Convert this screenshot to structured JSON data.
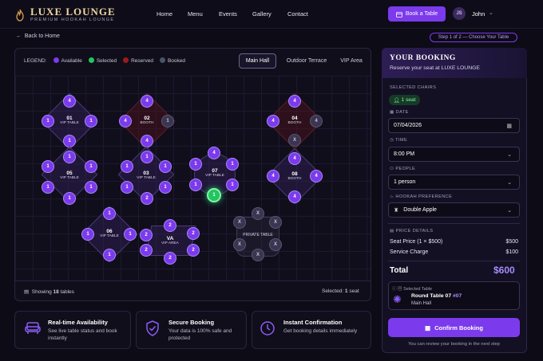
{
  "brand": {
    "name": "LUXE LOUNGE",
    "tagline": "PREMIUM HOOKAH LOUNGE"
  },
  "nav": {
    "links": [
      "Home",
      "Menu",
      "Events",
      "Gallery",
      "Contact"
    ],
    "book_label": "Book a Table",
    "user_initials": "JS",
    "user_name": "John"
  },
  "back_label": "Back to Home",
  "step_label": "Step 1 of 2 — Choose Your Table",
  "legend": {
    "title": "LEGEND:",
    "items": [
      "Available",
      "Selected",
      "Reserved",
      "Booked"
    ]
  },
  "colors": {
    "available": "#7c3aed",
    "selected": "#22c55e",
    "reserved": "#7f1d1d",
    "booked": "#475569",
    "accent": "#7c3aed"
  },
  "tabs": [
    "Main Hall",
    "Outdoor Terrace",
    "VIP Area"
  ],
  "tables": [
    {
      "id": "01",
      "type": "VIP TABLE",
      "seats": [
        "4",
        "1",
        "1",
        "1"
      ]
    },
    {
      "id": "02",
      "type": "BOOTH",
      "seats": [
        "4",
        "4",
        "1",
        "4"
      ]
    },
    {
      "id": "03",
      "type": "VIP TABLE",
      "seats": [
        "1",
        "1",
        "1",
        "1",
        "1",
        "2"
      ]
    },
    {
      "id": "04",
      "type": "BOOTH",
      "seats": [
        "4",
        "4",
        "4",
        "X"
      ]
    },
    {
      "id": "05",
      "type": "VIP TABLE",
      "seats": [
        "1",
        "1",
        "1",
        "1",
        "1"
      ]
    },
    {
      "id": "06",
      "type": "VIP TABLE",
      "seats": [
        "1",
        "1",
        "1",
        "1"
      ]
    },
    {
      "id": "07",
      "type": "VIP TABLE",
      "seats": [
        "4",
        "1",
        "1",
        "1",
        "1",
        "1"
      ]
    },
    {
      "id": "08",
      "type": "BOOTH",
      "seats": [
        "4",
        "4",
        "4",
        "4"
      ]
    },
    {
      "id": "VA",
      "type": "VIP AREA",
      "seats": [
        "2",
        "2",
        "2",
        "2",
        "2",
        "2"
      ]
    },
    {
      "id": "",
      "type": "PRIVATE TABLE",
      "seats": [
        "X",
        "X",
        "X",
        "X",
        "X",
        "X",
        "X",
        "X"
      ]
    }
  ],
  "footer": {
    "showing_prefix": "Showing",
    "showing_count": "18",
    "showing_suffix": "tables",
    "selected_prefix": "Selected:",
    "selected_count": "1",
    "selected_suffix": "seat"
  },
  "features": [
    {
      "title": "Real-time Availability",
      "desc": "See live table status and book instantly",
      "icon": "sofa-icon"
    },
    {
      "title": "Secure Booking",
      "desc": "Your data is 100% safe and protected",
      "icon": "shield-check-icon"
    },
    {
      "title": "Instant Confirmation",
      "desc": "Get booking details immediately",
      "icon": "clock-icon"
    }
  ],
  "booking": {
    "title": "YOUR BOOKING",
    "subtitle": "Reserve your seat at LUXE LOUNGE",
    "chairs_label": "SELECTED CHAIRS",
    "chairs_value": "1 seat",
    "date_label": "DATE",
    "date_value": "07/04/2026",
    "time_label": "TIME",
    "time_value": "8:00 PM",
    "people_label": "PEOPLE",
    "people_value": "1 person",
    "hookah_label": "HOOKAH PREFERENCE",
    "hookah_value": "Double Apple",
    "price_label": "PRICE DETAILS",
    "seat_price_label": "Seat Price (1 × $500)",
    "seat_price_value": "$500",
    "service_label": "Service Charge",
    "service_value": "$100",
    "total_label": "Total",
    "total_value": "$600",
    "selected_table_label": "Selected Table",
    "selected_table_name": "Round Table 07",
    "selected_table_num": "#07",
    "selected_table_area": "Main Hall",
    "confirm_label": "Confirm Booking",
    "note": "You can review your booking in the next step"
  }
}
